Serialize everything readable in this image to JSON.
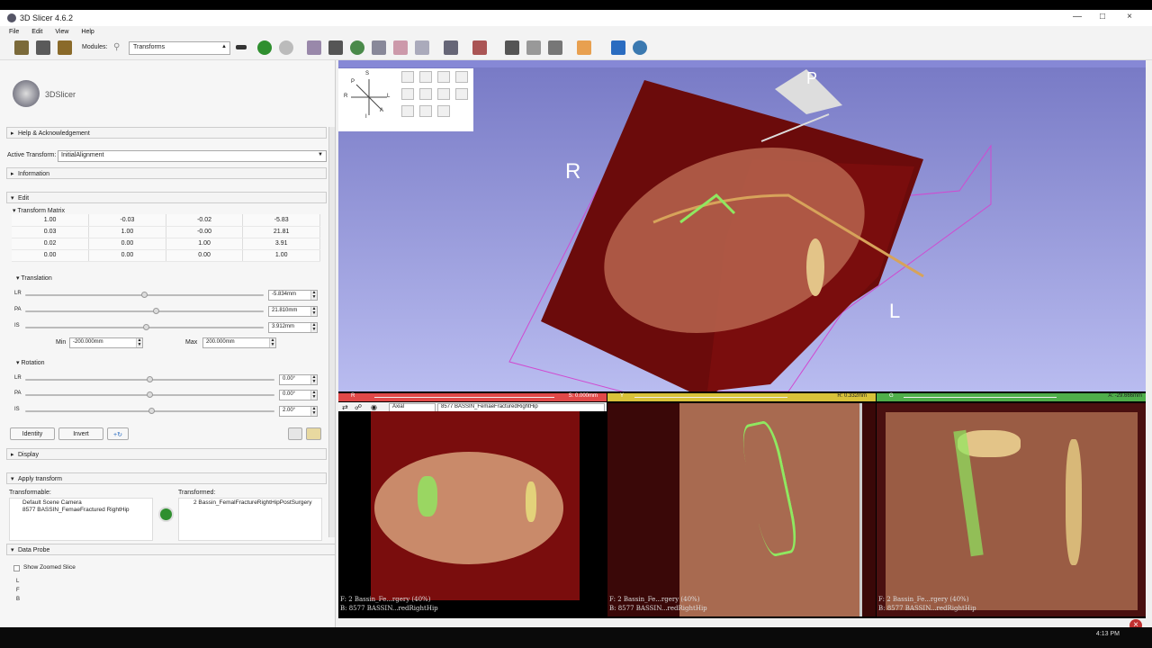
{
  "window": {
    "title": "3D Slicer 4.6.2",
    "minimize": "―",
    "maximize": "□",
    "close": "×"
  },
  "menu": [
    "File",
    "Edit",
    "View",
    "Help"
  ],
  "toolbar": {
    "modules_label": "Modules:",
    "module_selected": "Transforms",
    "colors": {
      "green": "#2f8f2f",
      "blue": "#2a6cc0",
      "python": "#3b79b0",
      "cyan": "#20a0c8"
    }
  },
  "panel": {
    "logo_text": "3DSlicer",
    "help_section": "Help & Acknowledgement",
    "active_transform_label": "Active Transform:",
    "active_transform_value": "InitialAlignment",
    "information_section": "Information",
    "edit_section": "Edit",
    "matrix_label": "Transform Matrix",
    "matrix": [
      [
        "1.00",
        "-0.03",
        "-0.02",
        "-5.83"
      ],
      [
        "0.03",
        "1.00",
        "-0.00",
        "21.81"
      ],
      [
        "0.02",
        "0.00",
        "1.00",
        "3.91"
      ],
      [
        "0.00",
        "0.00",
        "0.00",
        "1.00"
      ]
    ],
    "translation_label": "Translation",
    "translation": [
      {
        "axis": "LR",
        "value": "-5.834mm",
        "level": 0.5
      },
      {
        "axis": "PA",
        "value": "21.810mm",
        "level": 0.55
      },
      {
        "axis": "IS",
        "value": "3.912mm",
        "level": 0.51
      }
    ],
    "min_label": "Min",
    "min_value": "-200.000mm",
    "max_label": "Max",
    "max_value": "200.000mm",
    "rotation_label": "Rotation",
    "rotation": [
      {
        "axis": "LR",
        "value": "0.00°",
        "level": 0.5
      },
      {
        "axis": "PA",
        "value": "0.00°",
        "level": 0.5
      },
      {
        "axis": "IS",
        "value": "2.00°",
        "level": 0.51
      }
    ],
    "identity_button": "Identity",
    "invert_button": "Invert",
    "display_section": "Display",
    "apply_section": "Apply transform",
    "transformable_label": "Transformable:",
    "transformable_items": [
      "Default Scene Camera",
      "8577 BASSIN_FemaeFractured RightHip"
    ],
    "transformed_label": "Transformed:",
    "transformed_items": [
      "2 Bassin_FemalFractureRightHipPostSurgery"
    ],
    "data_probe_section": "Data Probe",
    "show_zoomed_label": "Show Zoomed Slice",
    "probe_letters": [
      "L",
      "F",
      "B"
    ]
  },
  "view3d": {
    "label_r": "R",
    "label_l": "L",
    "label_p": "P",
    "orient": {
      "s": "S",
      "p": "P",
      "r": "R",
      "l": "L",
      "a": "A",
      "i": "I"
    }
  },
  "slices": {
    "red": {
      "letter": "R",
      "offset": "S: 0.000mm",
      "color": "#e04848",
      "orientation": "Axial",
      "volume": "8577 BASSIN_FemaeFracturedRightHip",
      "fg": "F: 2 Bassin_Fe...rgery (40%)",
      "bg": "B: 8577 BASSIN...redRightHip"
    },
    "yellow": {
      "letter": "Y",
      "offset": "R: 0.332mm",
      "color": "#d8c23a",
      "fg": "F: 2 Bassin_Fe...rgery (40%)",
      "bg": "B: 8577 BASSIN...redRightHip"
    },
    "green": {
      "letter": "G",
      "offset": "A: -29.666mm",
      "color": "#4fae4a",
      "fg": "F: 2 Bassin_Fe...rgery (40%)",
      "bg": "B: 8577 BASSIN...redRightHip"
    }
  },
  "taskbar": {
    "time": "4:13 PM"
  }
}
